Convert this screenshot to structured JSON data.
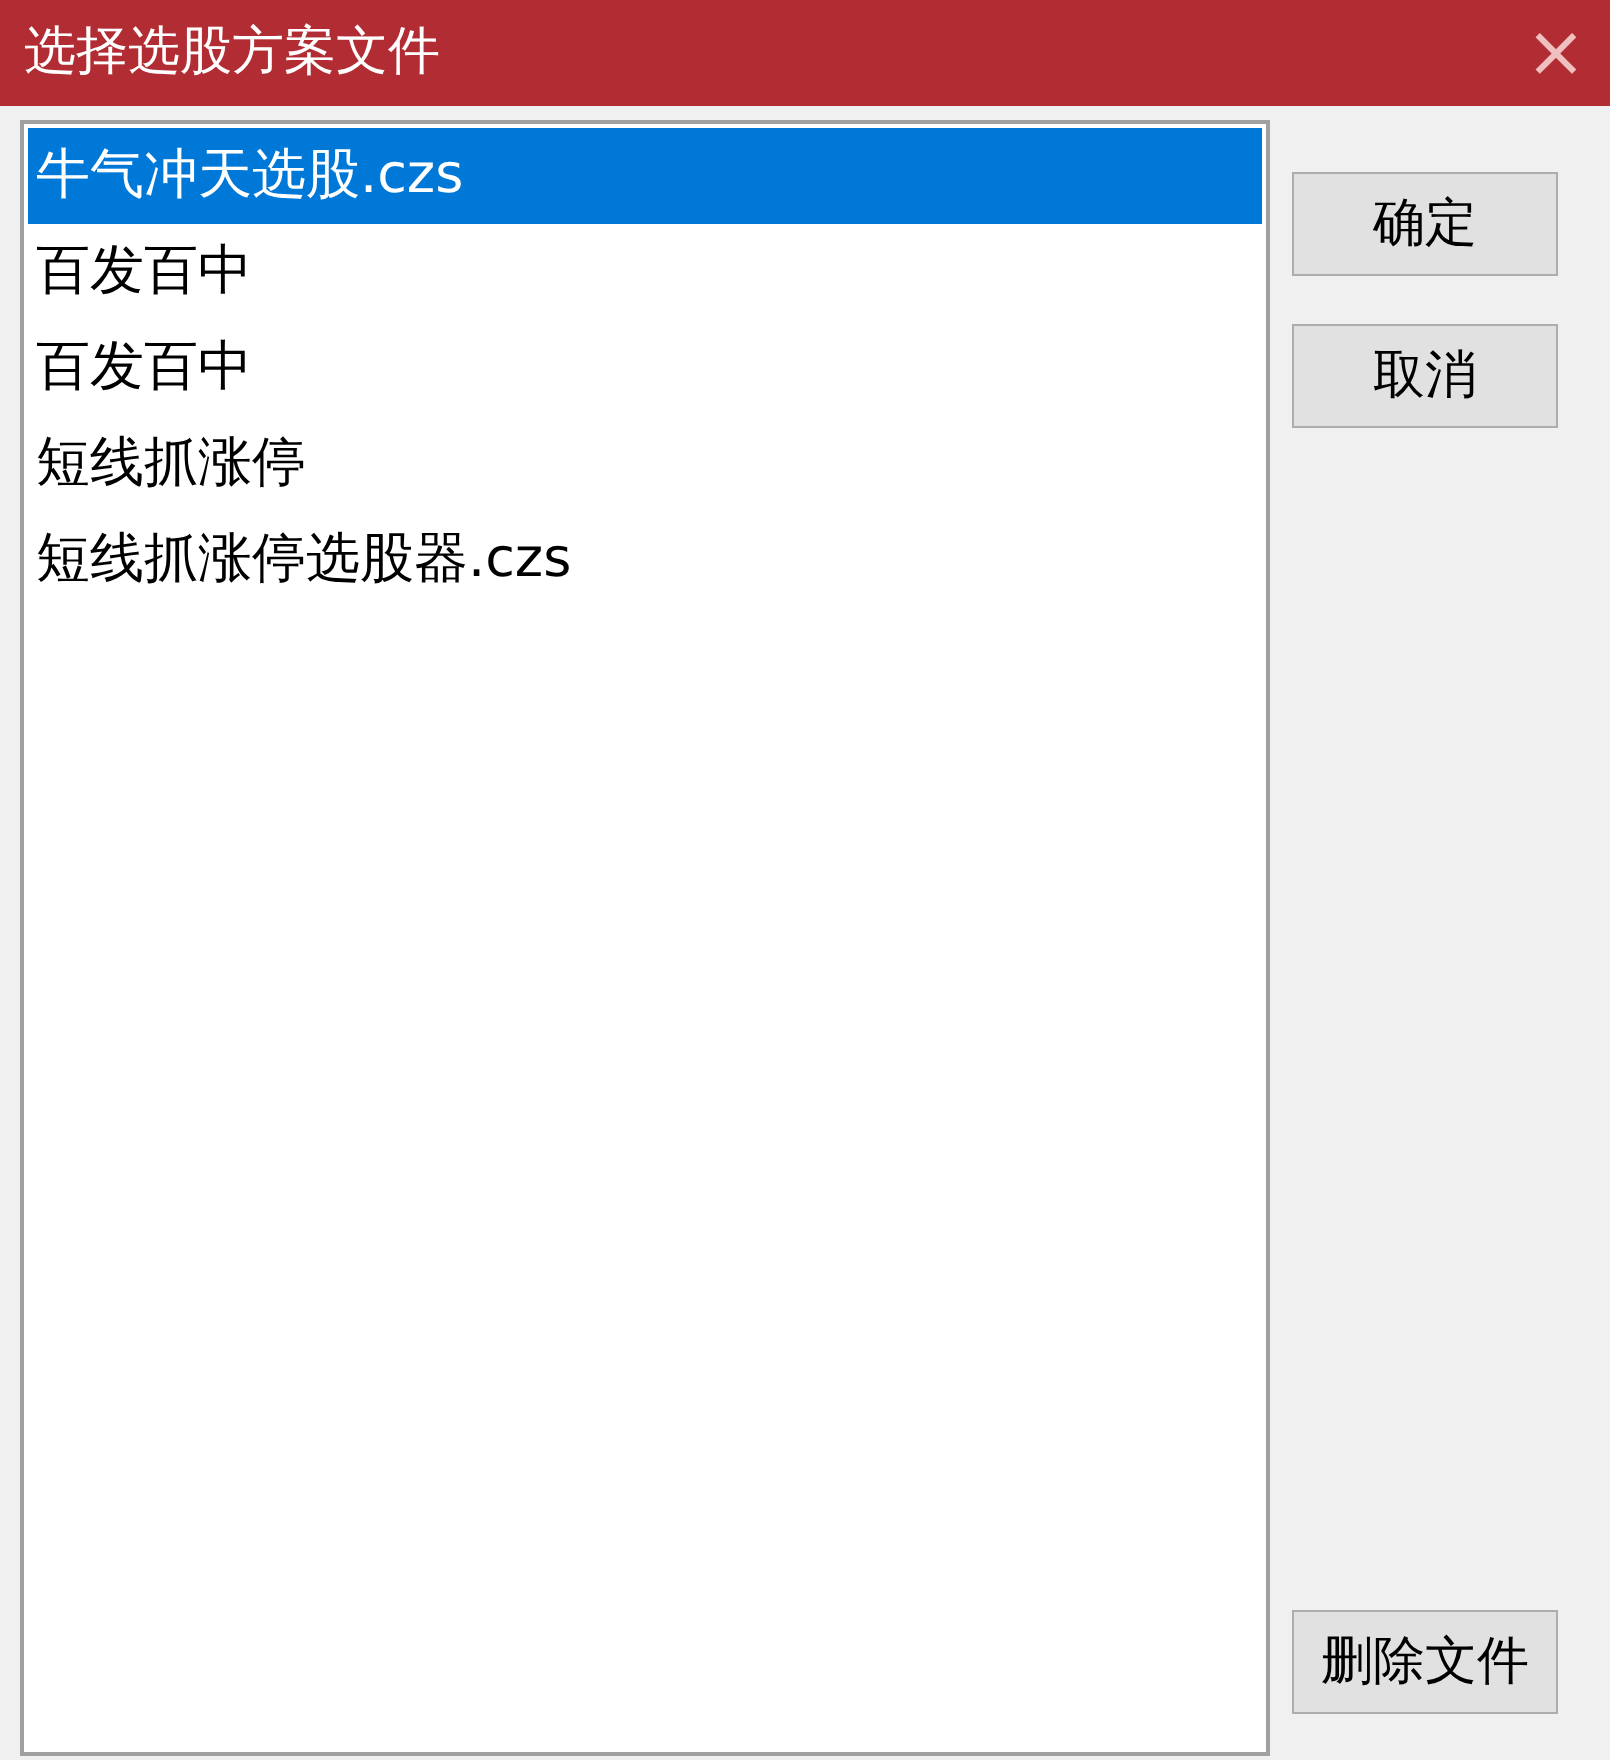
{
  "window": {
    "title": "选择选股方案文件",
    "close": "×"
  },
  "files": [
    {
      "name": "牛气冲天选股.czs",
      "selected": true
    },
    {
      "name": "百发百中",
      "selected": false
    },
    {
      "name": "百发百中",
      "selected": false
    },
    {
      "name": "短线抓涨停",
      "selected": false
    },
    {
      "name": "短线抓涨停选股器.czs",
      "selected": false
    }
  ],
  "buttons": [
    {
      "label": "确定",
      "kind": "top"
    },
    {
      "label": "取消",
      "kind": "top"
    },
    {
      "label": "删除文件",
      "kind": "bottom"
    }
  ]
}
